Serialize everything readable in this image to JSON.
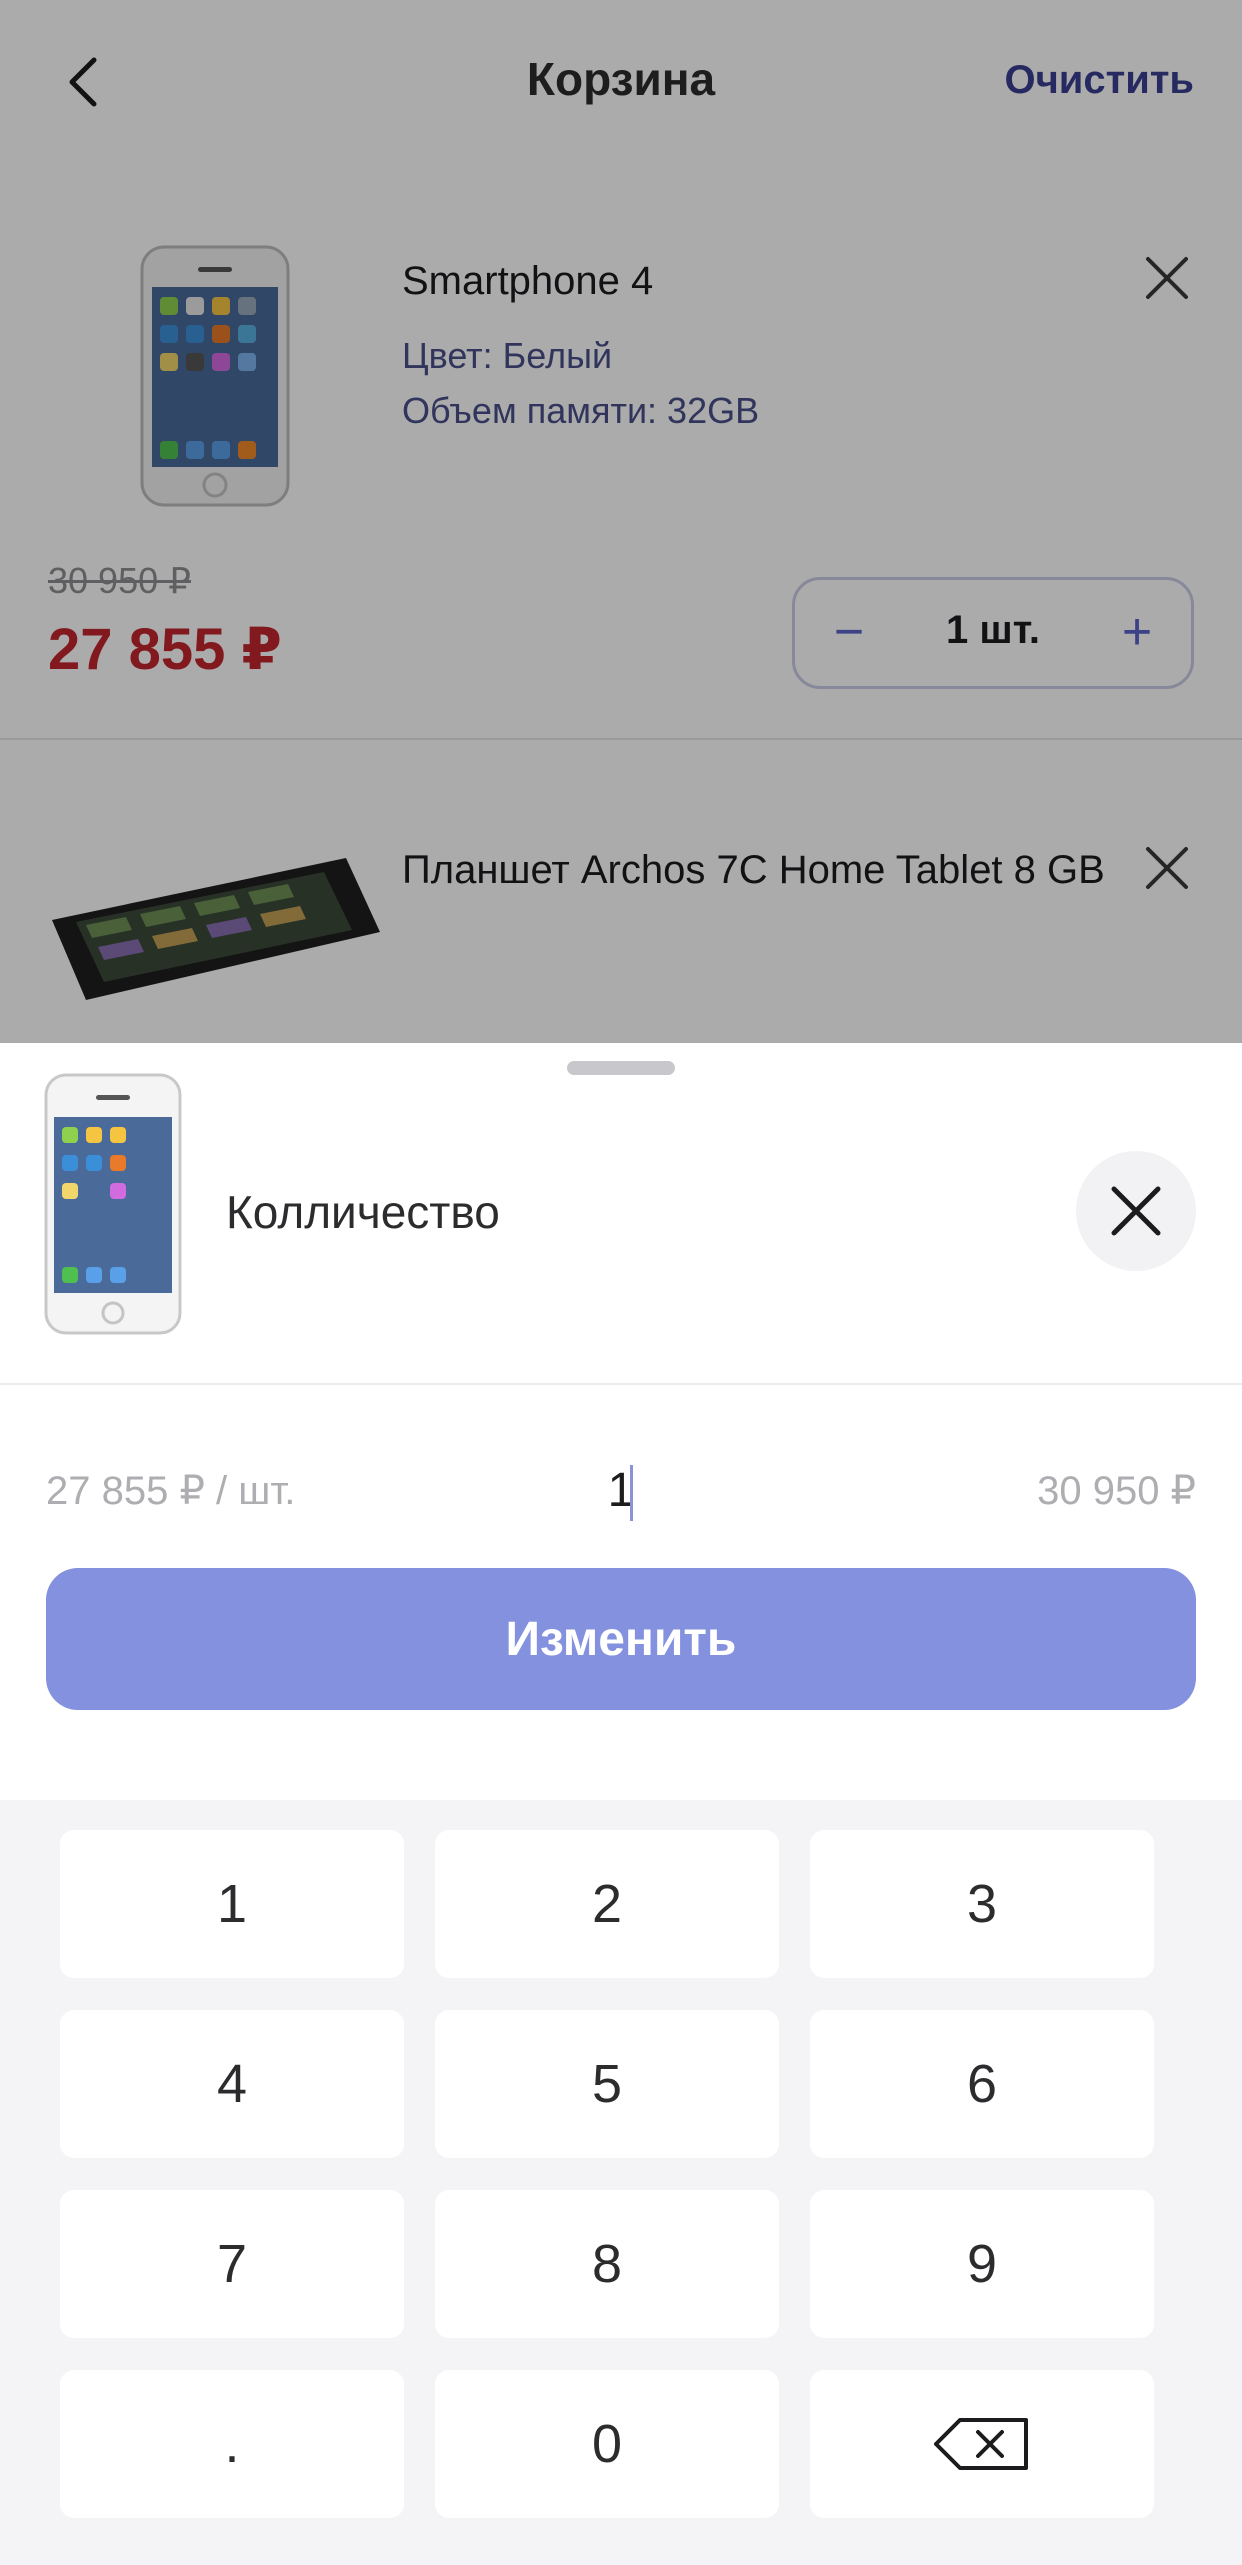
{
  "header": {
    "title": "Корзина",
    "clear_label": "Очистить"
  },
  "cart": {
    "items": [
      {
        "name": "Smartphone 4",
        "color_attr": "Цвет: Белый",
        "memory_attr": "Объем памяти: 32GB",
        "old_price": "30 950 ₽",
        "new_price": "27 855 ₽",
        "quantity_label": "1 шт.",
        "minus": "−",
        "plus": "+"
      },
      {
        "name": "Планшет Archos 7C Home Tablet 8 GB"
      }
    ]
  },
  "sheet": {
    "title": "Колличество",
    "unit_price": "27 855 ₽ / шт.",
    "quantity_value": "1",
    "total_price": "30 950 ₽",
    "submit_label": "Изменить"
  },
  "keypad": {
    "keys": [
      "1",
      "2",
      "3",
      "4",
      "5",
      "6",
      "7",
      "8",
      "9",
      ".",
      "0"
    ],
    "backspace_icon": "backspace-icon"
  },
  "colors": {
    "accent": "#8391de",
    "price_red": "#c0262d",
    "link": "#3a3f8f"
  }
}
